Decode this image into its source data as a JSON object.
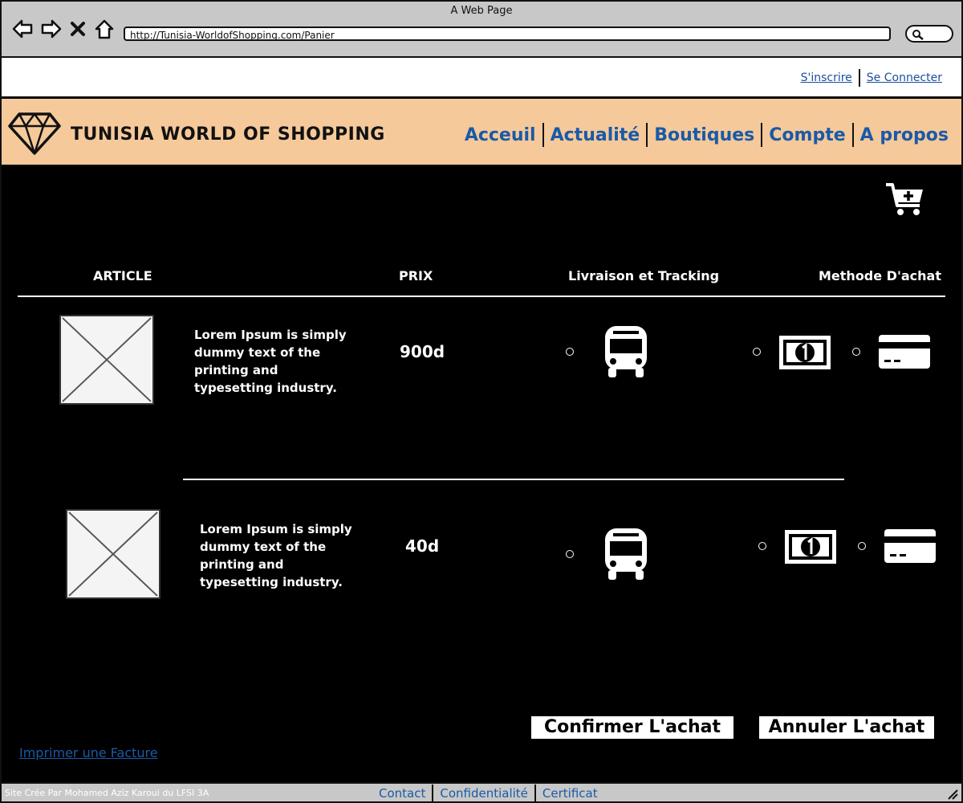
{
  "window": {
    "title": "A Web Page",
    "url": "http://Tunisia-WorldofShopping.com/Panier"
  },
  "auth": {
    "signup": "S'inscrire",
    "login": "Se Connecter"
  },
  "header": {
    "brand": "TUNISIA WORLD OF SHOPPING",
    "menu": [
      "Acceuil",
      "Actualité",
      "Boutiques",
      "Compte",
      "A propos"
    ]
  },
  "table": {
    "headers": {
      "article": "ARTICLE",
      "price": "PRIX",
      "delivery": "Livraison et Tracking",
      "payment": "Methode D'achat"
    }
  },
  "items": [
    {
      "description": "Lorem Ipsum is simply dummy text of the printing and typesetting industry.",
      "price": "900d"
    },
    {
      "description": "Lorem Ipsum is simply dummy text of the printing and typesetting industry.",
      "price": "40d"
    }
  ],
  "actions": {
    "confirm": "Confirmer L'achat",
    "cancel": "Annuler L'achat",
    "invoice": "Imprimer une Facture"
  },
  "footer": {
    "credit": "Site Crée Par Mohamed Aziz Karoui du LFSI 3A",
    "links": [
      "Contact",
      "Confidentialité",
      "Certificat"
    ]
  },
  "colors": {
    "header_bg": "#f5c99a",
    "link": "#1a5aa8",
    "content_bg": "#000000",
    "chrome": "#c8c8c8"
  }
}
